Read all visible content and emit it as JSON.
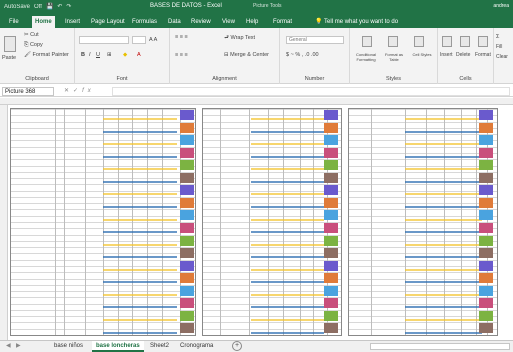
{
  "titlebar": {
    "quick_access": [
      "AutoSave",
      "Off",
      "💾",
      "↶",
      "↷"
    ],
    "title": "BASES DE DATOS - Excel",
    "context_tab": "Picture Tools",
    "user": "andrea"
  },
  "tabs": [
    "File",
    "Home",
    "Insert",
    "Page Layout",
    "Formulas",
    "Data",
    "Review",
    "View",
    "Help",
    "Format"
  ],
  "active_tab": "Home",
  "tell_me": "Tell me what you want to do",
  "ribbon": {
    "clipboard": {
      "paste": "Paste",
      "cut": "Cut",
      "copy": "Copy",
      "format_painter": "Format Painter",
      "label": "Clipboard"
    },
    "font": {
      "font_name": "",
      "font_size": "",
      "label": "Font"
    },
    "alignment": {
      "wrap": "Wrap Text",
      "merge": "Merge & Center",
      "label": "Alignment"
    },
    "number": {
      "format": "General",
      "label": "Number"
    },
    "styles": {
      "conditional": "Conditional Formatting",
      "format_table": "Format as Table",
      "cell_styles": "Cell Styles",
      "label": "Styles"
    },
    "cells": {
      "insert": "Insert",
      "delete": "Delete",
      "format": "Format",
      "label": "Cells"
    },
    "editing": {
      "fill": "Fill",
      "clear": "Clear"
    }
  },
  "formula_bar": {
    "name_box": "Picture 368",
    "fx": "fx",
    "value": ""
  },
  "sheet_tabs": [
    "base niños",
    "base loncheras",
    "Sheet2",
    "Cronograma"
  ],
  "active_sheet": "base loncheras"
}
